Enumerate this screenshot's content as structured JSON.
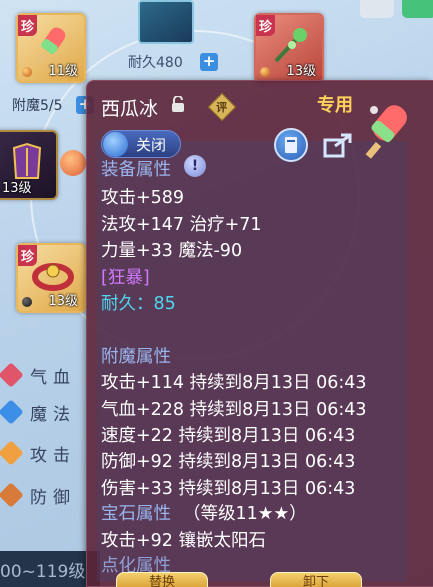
{
  "background": {
    "slots": [
      {
        "level": "11级",
        "rarity": "珍",
        "item": "popsicle-weapon"
      },
      {
        "level": "13级",
        "rarity": "珍",
        "item": "green-staff"
      },
      {
        "level": "13级",
        "rarity": "",
        "item": "armor"
      },
      {
        "level": "13级",
        "rarity": "珍",
        "item": "red-belt"
      }
    ],
    "durability_label": "耐久480",
    "enchant_label": "附魔5/5",
    "side_stats": [
      "气血",
      "魔法",
      "攻击",
      "防御"
    ],
    "bottom_text": "00~119级",
    "colors": {
      "hp": "#e0556a",
      "mp": "#3b8fe6",
      "atk": "#f0a040",
      "def": "#d77a3a"
    }
  },
  "tooltip": {
    "item_name": "西瓜冰",
    "exclusive_label": "专用",
    "eval_label": "评",
    "toggle_label": "关闭",
    "equip_attr_header": "装备属性",
    "base_attrs": [
      "攻击+589",
      "法攻+147 治疗+71",
      "力量+33 魔法-90"
    ],
    "special_effect": "[狂暴]",
    "durability": "耐久：85",
    "enchant_header": "附魔属性",
    "enchant_attrs": [
      "攻击+114 持续到8月13日 06:43",
      "气血+228 持续到8月13日 06:43",
      "速度+22 持续到8月13日 06:43",
      "防御+92 持续到8月13日 06:43",
      "伤害+33 持续到8月13日 06:43"
    ],
    "gem_header": "宝石属性",
    "gem_level": "（等级11★★）",
    "gem_attr": "攻击+92 镶嵌太阳石",
    "refine_header": "点化属性",
    "footer_buttons": [
      "替换",
      "卸下"
    ],
    "colors": {
      "panel": "#5c2438",
      "header": "#9ab4ee",
      "gold": "#ffd15a",
      "purple": "#d079ff",
      "cyan": "#4fd6f0"
    }
  }
}
